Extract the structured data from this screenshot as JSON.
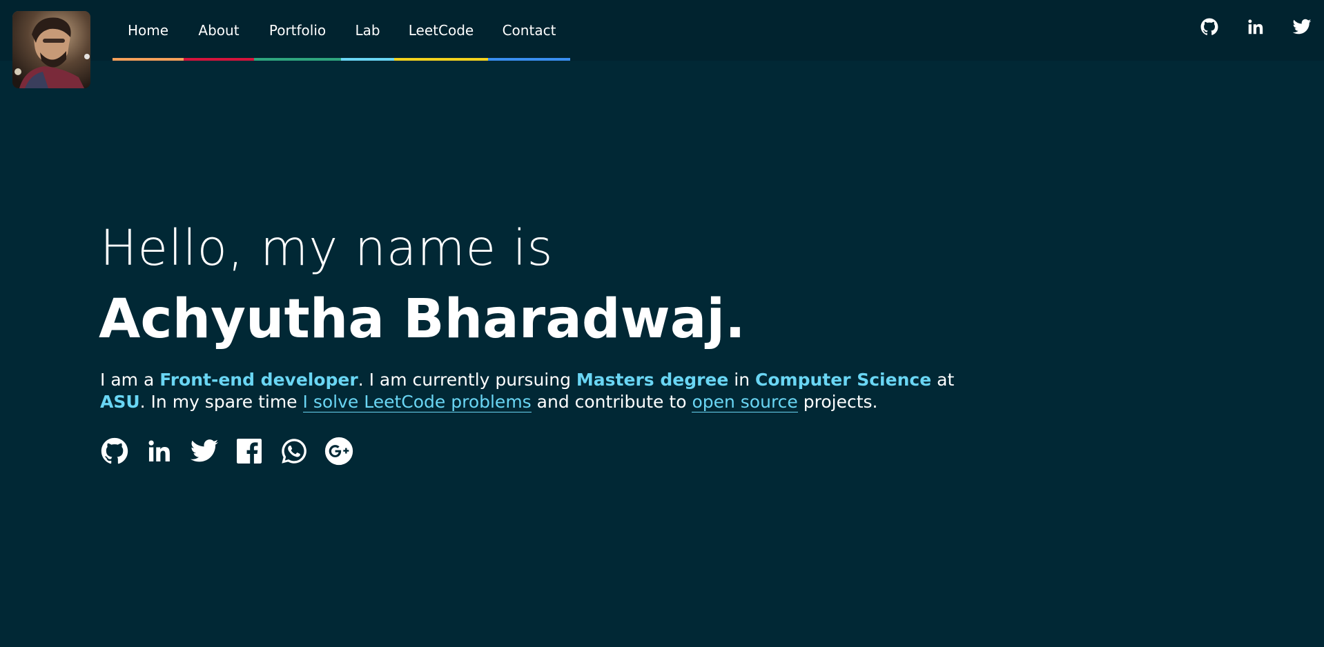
{
  "nav": {
    "items": [
      {
        "label": "Home",
        "accent": "#f5a05a"
      },
      {
        "label": "About",
        "accent": "#d4143c"
      },
      {
        "label": "Portfolio",
        "accent": "#2fa57e"
      },
      {
        "label": "Lab",
        "accent": "#6ad6f4"
      },
      {
        "label": "LeetCode",
        "accent": "#f2d21e"
      },
      {
        "label": "Contact",
        "accent": "#3a8ef0"
      }
    ]
  },
  "header_social": [
    "github-icon",
    "linkedin-icon",
    "twitter-icon"
  ],
  "hero": {
    "greeting": "Hello, my name is",
    "name": "Achyutha Bharadwaj.",
    "bio": {
      "t1": "I am a ",
      "h1": "Front-end developer",
      "t2": ". I am currently pursuing ",
      "h2": "Masters degree",
      "t3": " in ",
      "h3": "Computer Science",
      "t4": " at ",
      "h4": "ASU",
      "t5": ". In my spare time ",
      "link1": "I solve LeetCode problems",
      "t6": " and contribute to ",
      "link2": "open source",
      "t7": " projects."
    }
  },
  "hero_social": [
    "github-icon",
    "linkedin-icon",
    "twitter-icon",
    "facebook-icon",
    "whatsapp-icon",
    "google-plus-icon"
  ],
  "colors": {
    "background": "#012835",
    "header": "#01232f",
    "highlight": "#6ad6f4"
  }
}
